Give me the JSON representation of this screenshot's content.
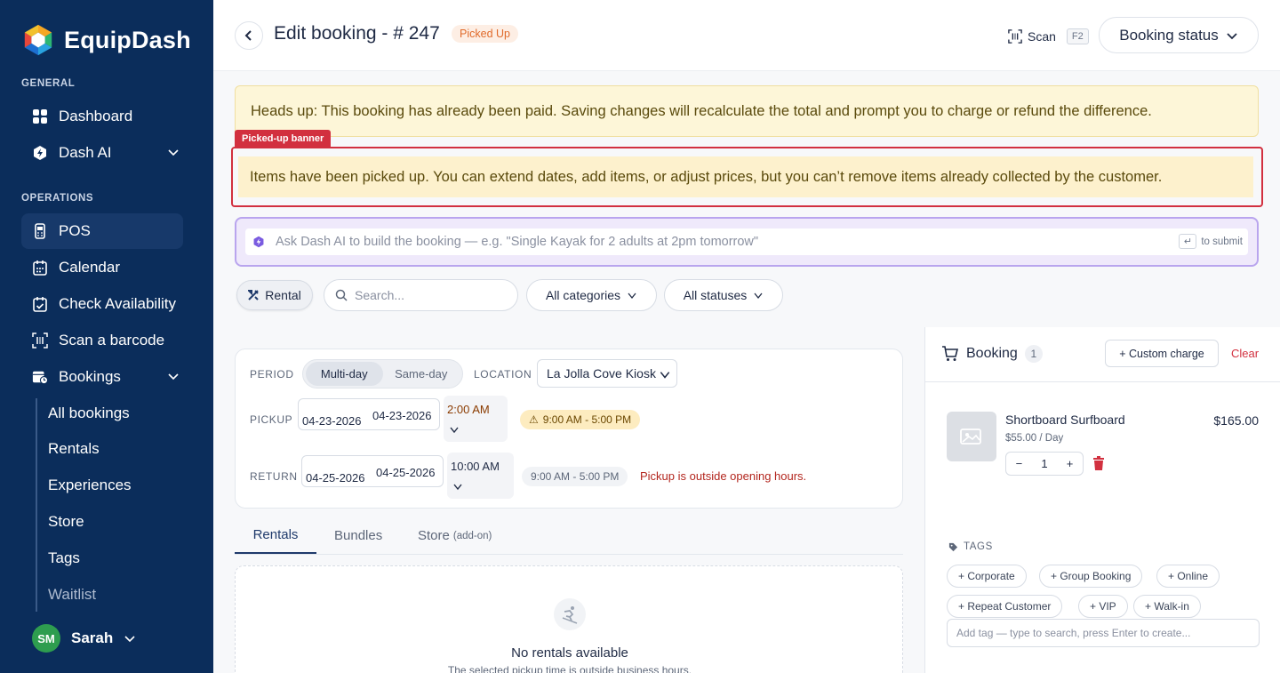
{
  "sidebar": {
    "brand": "EquipDash",
    "sections": {
      "general": "GENERAL",
      "operations": "OPERATIONS"
    },
    "items": {
      "dashboard": "Dashboard",
      "dash_ai": "Dash AI",
      "pos": "POS",
      "calendar": "Calendar",
      "check_availability": "Check Availability",
      "scan_barcode": "Scan a barcode",
      "bookings": "Bookings"
    },
    "sub_items": {
      "all_bookings": "All bookings",
      "rentals": "Rentals",
      "experiences": "Experiences",
      "store": "Store",
      "tags": "Tags",
      "waitlist": "Waitlist"
    },
    "user": {
      "initials": "SM",
      "name": "Sarah"
    },
    "colors": {
      "background": "#0b2d5b",
      "active": "#17396a",
      "avatar": "#2e9d4f"
    }
  },
  "header": {
    "title": "Edit booking - # 247",
    "status_badge": "Picked Up",
    "scan_label": "Scan",
    "scan_shortcut": "F2",
    "booking_status_label": "Booking status"
  },
  "banners": {
    "paid": "Heads up: This booking has already been paid. Saving changes will recalculate the total and prompt you to charge or refund the difference.",
    "picked_tag": "Picked-up banner",
    "picked": "Items have been picked up. You can extend dates, add items, or adjust prices, but you can’t remove items already collected by the customer."
  },
  "ai": {
    "placeholder": "Ask Dash AI to build the booking — e.g. \"Single Kayak for 2 adults at 2pm tomorrow\"",
    "submit_key": "↵",
    "submit_hint": "to submit"
  },
  "filters": {
    "rental": "Rental",
    "search_placeholder": "Search...",
    "categories": "All categories",
    "statuses": "All statuses"
  },
  "period": {
    "period_label": "PERIOD",
    "options": [
      "Multi-day",
      "Same-day"
    ],
    "selected": "Multi-day",
    "location_label": "LOCATION",
    "location_value": "La Jolla Cove Kiosk",
    "pickup_label": "PICKUP",
    "pickup_date_a": "04-23-2026",
    "pickup_date_b": "04-23-2026",
    "pickup_time": "2:00 AM",
    "pickup_hours": "9:00 AM - 5:00 PM",
    "return_label": "RETURN",
    "return_date_a": "04-25-2026",
    "return_date_b": "04-25-2026",
    "return_time": "10:00 AM",
    "return_hours": "9:00 AM - 5:00 PM",
    "error": "Pickup is outside opening hours."
  },
  "tabs": {
    "rentals": "Rentals",
    "bundles": "Bundles",
    "store": "Store",
    "store_note": "(add-on)"
  },
  "empty": {
    "title": "No rentals available",
    "subtitle": "The selected pickup time is outside business hours."
  },
  "booking": {
    "title": "Booking",
    "count": "1",
    "custom_charge": "+ Custom charge",
    "clear": "Clear",
    "item": {
      "name": "Shortboard Surfboard",
      "rate": "$55.00 / Day",
      "price": "$165.00",
      "qty": "1",
      "minus": "−",
      "plus": "+"
    },
    "tags_label": "TAGS",
    "tags": [
      "+ Corporate",
      "+ Group Booking",
      "+ Online",
      "+ Repeat Customer",
      "+ VIP",
      "+ Walk-in"
    ],
    "tag_input_placeholder": "Add tag — type to search, press Enter to create..."
  }
}
